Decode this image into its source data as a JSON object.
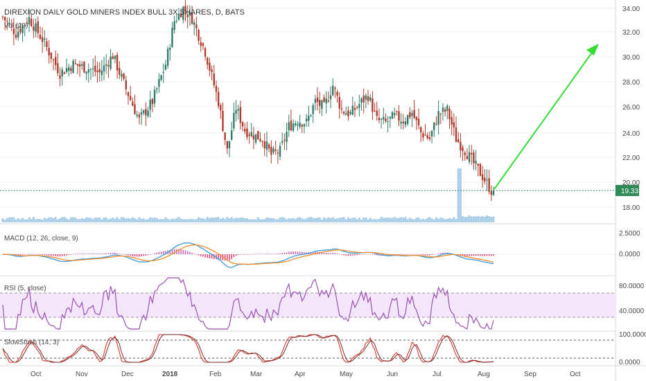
{
  "chart": {
    "title": "DIREXION DAILY GOLD MINERS INDEX BULL 3X SHARES, D, BATS",
    "volume_label": "Vol (20)",
    "last_price_label": "19.33",
    "x_labels": [
      "Oct",
      "Nov",
      "Dec",
      "2018",
      "Feb",
      "Mar",
      "Apr",
      "May",
      "Jun",
      "Jul",
      "Aug",
      "Sep",
      "Oct"
    ]
  },
  "panels": {
    "macd": {
      "label": "MACD (12, 26, close, 9)",
      "ticks": [
        "2.5000",
        "0.0000"
      ]
    },
    "rsi": {
      "label": "RSI (5, close)",
      "ticks": [
        "80.0000",
        "40.0000"
      ]
    },
    "stoch": {
      "label": "SlowStoch (14, 3)",
      "ticks": [
        "100.0000",
        "0.0000"
      ]
    }
  },
  "colors": {
    "up": "#2e7d6a",
    "down": "#b23a2c",
    "volume": "#a9cfe8",
    "macd_line": "#3a9ad9",
    "signal_line": "#f08c2a",
    "rsi_line": "#9b4fb2",
    "rsi_band": "#f3e6fa",
    "stoch_k": "#d33a2c",
    "stoch_d": "#7a2a2a",
    "projection": "#33dd33",
    "last_price_line": "#2e8b57"
  },
  "chart_data": {
    "type": "candlestick",
    "y_axis_ticks": [
      "34.00",
      "32.00",
      "30.00",
      "28.00",
      "26.00",
      "24.00",
      "22.00",
      "20.00",
      "18.00"
    ],
    "ylim": [
      17.0,
      34.7
    ],
    "last_price": 19.33,
    "price_path_points": [
      [
        0,
        33.3
      ],
      [
        6,
        32.0
      ],
      [
        12,
        33.2
      ],
      [
        18,
        31.5
      ],
      [
        26,
        28.8
      ],
      [
        32,
        29.5
      ],
      [
        38,
        29.2
      ],
      [
        44,
        28.8
      ],
      [
        50,
        30.2
      ],
      [
        56,
        27.5
      ],
      [
        62,
        25.0
      ],
      [
        68,
        26.5
      ],
      [
        74,
        29.5
      ],
      [
        78,
        33.0
      ],
      [
        82,
        34.0
      ],
      [
        86,
        33.2
      ],
      [
        92,
        30.5
      ],
      [
        98,
        26.5
      ],
      [
        102,
        22.5
      ],
      [
        106,
        26.0
      ],
      [
        110,
        24.2
      ],
      [
        114,
        23.8
      ],
      [
        118,
        23.5
      ],
      [
        122,
        22.2
      ],
      [
        126,
        22.5
      ],
      [
        130,
        24.5
      ],
      [
        134,
        25.0
      ],
      [
        138,
        24.8
      ],
      [
        142,
        26.5
      ],
      [
        146,
        26.0
      ],
      [
        150,
        27.8
      ],
      [
        154,
        25.8
      ],
      [
        158,
        25.5
      ],
      [
        162,
        26.3
      ],
      [
        166,
        27.0
      ],
      [
        170,
        25.0
      ],
      [
        174,
        24.8
      ],
      [
        178,
        25.3
      ],
      [
        182,
        25.0
      ],
      [
        186,
        25.6
      ],
      [
        190,
        24.0
      ],
      [
        194,
        23.5
      ],
      [
        198,
        25.5
      ],
      [
        202,
        25.8
      ],
      [
        206,
        23.5
      ],
      [
        210,
        22.6
      ],
      [
        214,
        21.5
      ],
      [
        218,
        20.5
      ],
      [
        222,
        19.33
      ]
    ],
    "volume_spike": {
      "at": 207,
      "relative_height": 1.0
    }
  }
}
